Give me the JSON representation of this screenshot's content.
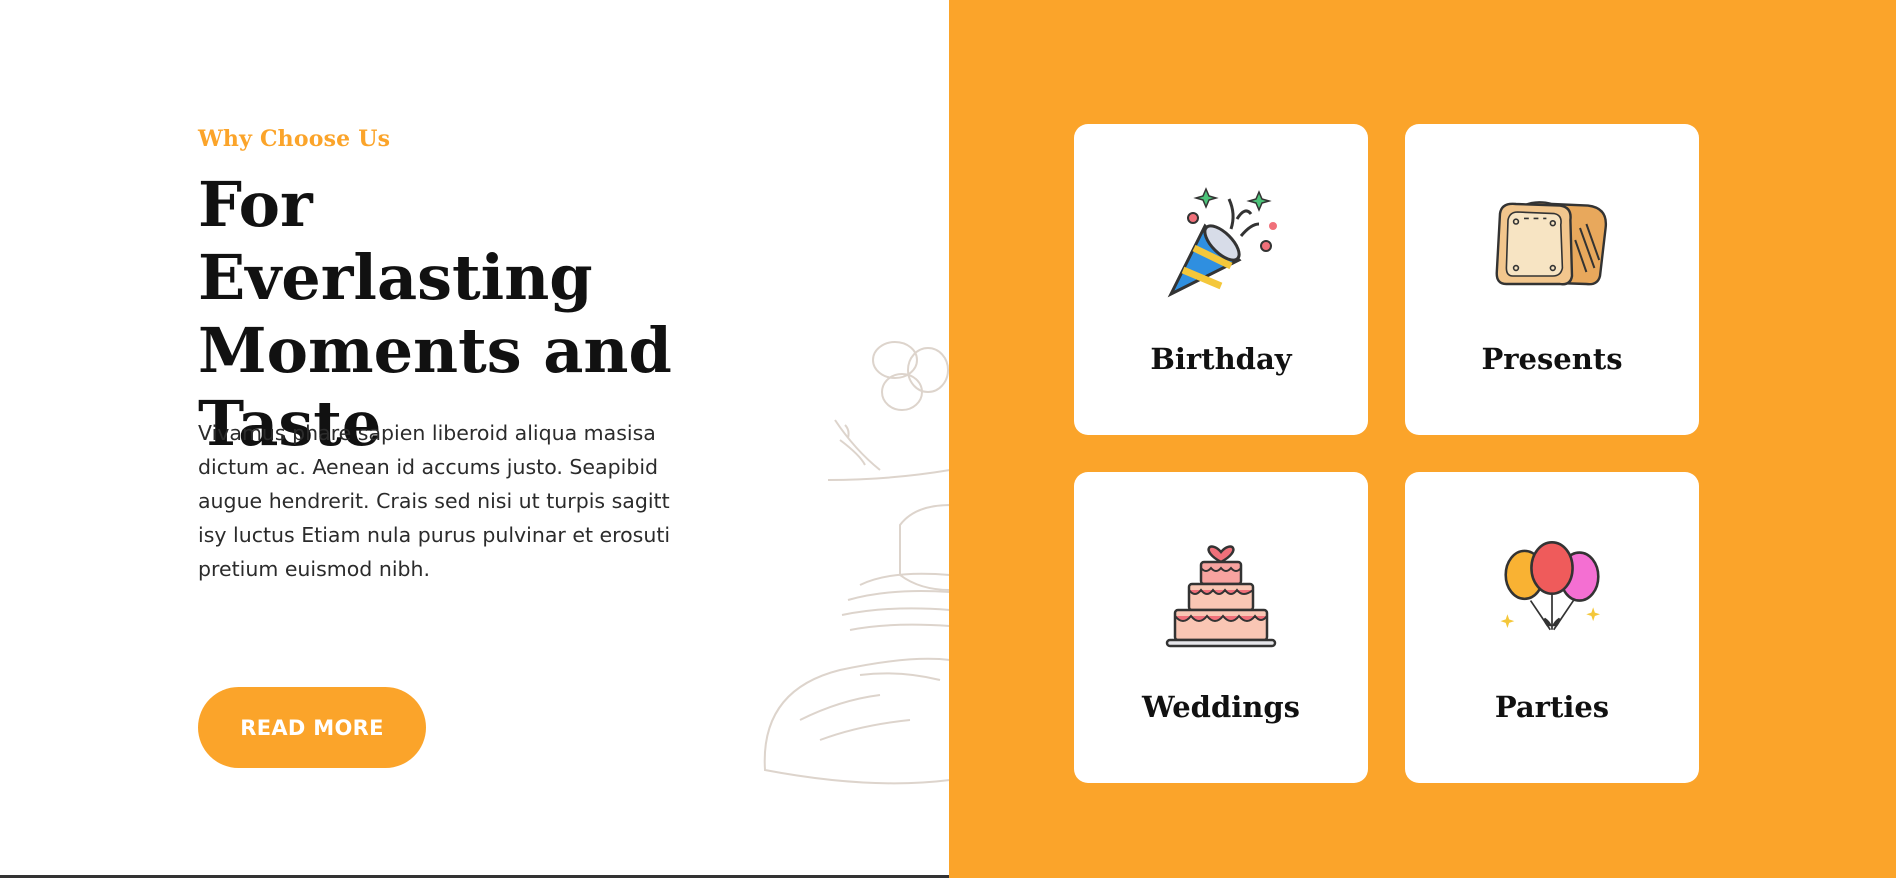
{
  "section": {
    "eyebrow": "Why Choose Us",
    "heading_lines": [
      "For Everlasting",
      "Moments and",
      "Taste"
    ],
    "paragraph_lines": [
      "Vivamus phare sapien liberoid aliqua masisa",
      "dictum ac. Aenean id accums justo. Seapibid",
      "augue hendrerit. Crais sed nisi ut turpis sagitt",
      "isy luctus Etiam nula purus pulvinar et erosuti",
      "pretium euismod nibh."
    ],
    "button_label": "READ MORE"
  },
  "cards": [
    {
      "label": "Birthday",
      "icon": "party-popper-icon"
    },
    {
      "label": "Presents",
      "icon": "bread-icon"
    },
    {
      "label": "Weddings",
      "icon": "wedding-cake-icon"
    },
    {
      "label": "Parties",
      "icon": "balloons-icon"
    }
  ],
  "colors": {
    "accent": "#fba42a",
    "heading": "#111111",
    "text": "#2b2b2b",
    "card_bg": "#ffffff"
  }
}
